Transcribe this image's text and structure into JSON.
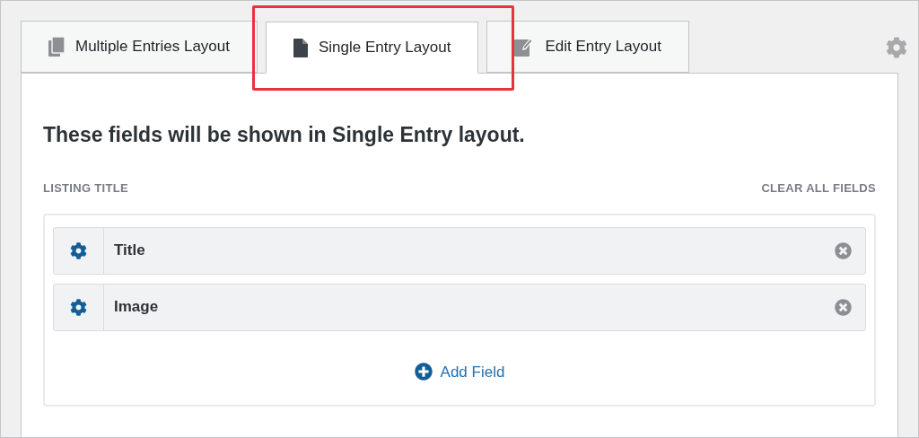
{
  "tabs": [
    {
      "label": "Multiple Entries Layout",
      "kind": "copies",
      "selected": false,
      "highlighted": false
    },
    {
      "label": "Single Entry Layout",
      "kind": "page",
      "selected": true,
      "highlighted": true
    },
    {
      "label": "Edit Entry Layout",
      "kind": "edit",
      "selected": false,
      "highlighted": false
    }
  ],
  "heading": "These fields will be shown in Single Entry layout.",
  "section": {
    "title": "LISTING TITLE",
    "clear_link": "CLEAR ALL FIELDS"
  },
  "fields": [
    {
      "label": "Title"
    },
    {
      "label": "Image"
    }
  ],
  "add_field": "Add Field"
}
